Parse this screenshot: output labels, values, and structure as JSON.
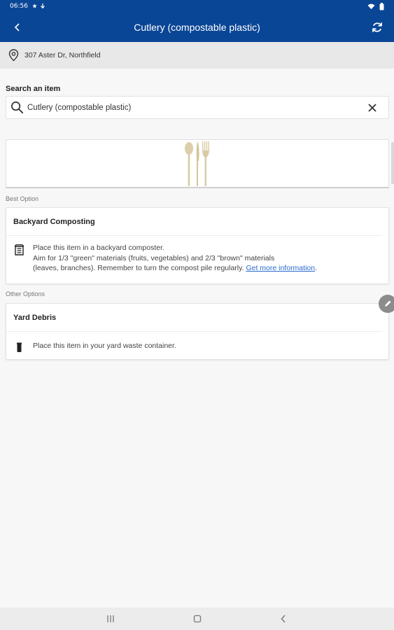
{
  "status_bar": {
    "time": "06:56",
    "left_icons": [
      "star-icon",
      "download-icon"
    ],
    "right_icons": [
      "wifi-icon",
      "battery-icon"
    ]
  },
  "app_bar": {
    "title": "Cutlery (compostable plastic)",
    "back_icon": "chevron-left-icon",
    "refresh_icon": "refresh-icon",
    "background": "#0a4696"
  },
  "address": {
    "text": "307 Aster Dr, Northfield",
    "icon": "location-pin-icon"
  },
  "search": {
    "label": "Search an item",
    "value": "Cutlery (compostable plastic)",
    "icon": "search-icon",
    "clear_icon": "close-icon"
  },
  "item_image": {
    "icon": "cutlery-icon"
  },
  "best_option": {
    "section_label": "Best Option",
    "title": "Backyard Composting",
    "icon": "compost-bin-icon",
    "lines": [
      "Place this item in a backyard composter.",
      "Aim for 1/3 \"green\" materials (fruits, vegetables) and 2/3 \"brown\" materials",
      "(leaves, branches). Remember to turn the compost pile regularly. "
    ],
    "link_text": "Get more information",
    "link_suffix": "."
  },
  "other_options": {
    "section_label": "Other Options",
    "items": [
      {
        "title": "Yard Debris",
        "icon": "yard-waste-bin-icon",
        "text": "Place this item in your yard waste container."
      }
    ]
  },
  "fab": {
    "icon": "pencil-icon"
  },
  "nav_bar": {
    "icons": [
      "recents-icon",
      "home-icon",
      "back-icon"
    ]
  }
}
